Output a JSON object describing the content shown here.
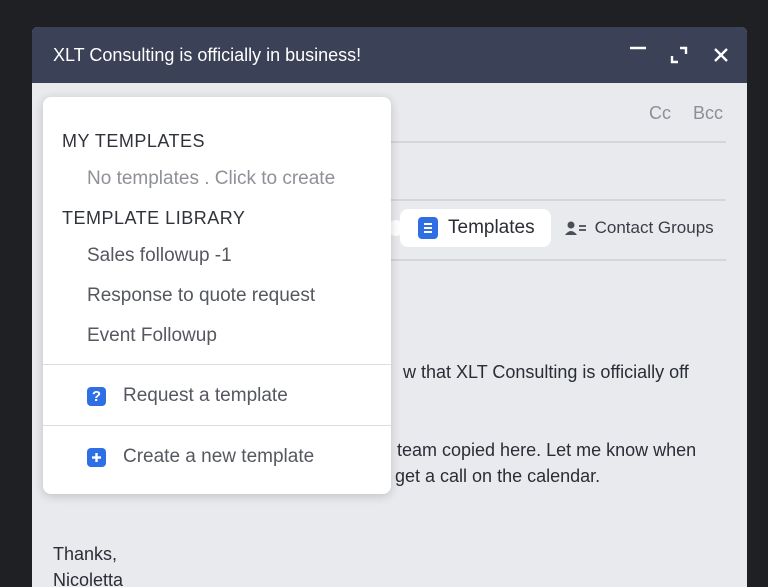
{
  "window": {
    "title": "XLT Consulting is officially in business!",
    "controls": {
      "minimize": "minimize-icon",
      "expand": "expand-icon",
      "close": "close-icon"
    }
  },
  "compose": {
    "cc_label": "Cc",
    "bcc_label": "Bcc",
    "toolbar": {
      "templates_label": "Templates",
      "templates_icon": "document-icon",
      "contact_groups_label": "Contact Groups",
      "contact_groups_icon": "contact-list-icon"
    },
    "body": {
      "line1_visible": "w that XLT Consulting is officially off",
      "line2_visible": "team copied here. Let me know when",
      "line3_visible": "get a call on the calendar.",
      "signoff": "Thanks,",
      "signature": "Nicoletta"
    }
  },
  "template_menu": {
    "my_templates_heading": "MY TEMPLATES",
    "my_templates_empty": "No templates . Click to create",
    "library_heading": "TEMPLATE LIBRARY",
    "library_items": [
      "Sales followup -1",
      "Response to quote request",
      "Event Followup"
    ],
    "request_label": "Request a template",
    "request_icon": "help-icon",
    "create_label": "Create a new template",
    "create_icon": "plus-icon"
  },
  "colors": {
    "titlebar": "#3b4156",
    "accent": "#2f6fe6",
    "background": "#1f2024"
  }
}
